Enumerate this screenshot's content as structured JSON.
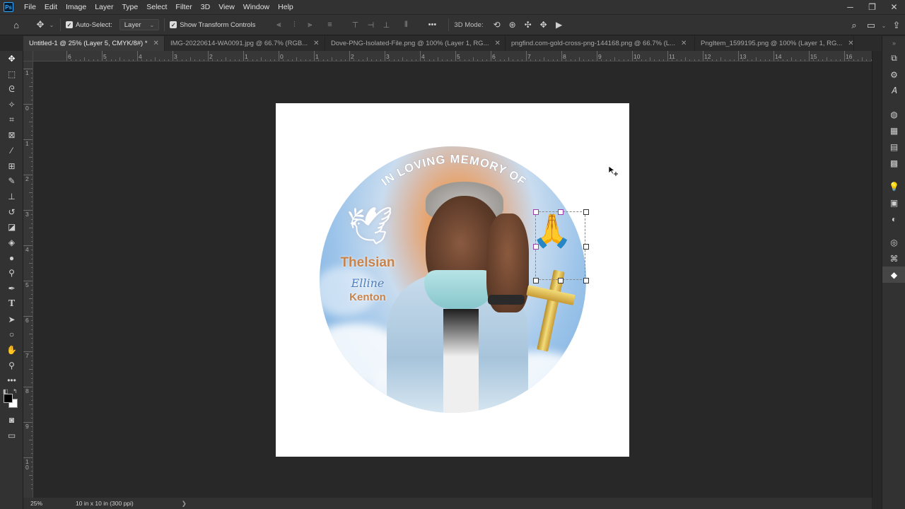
{
  "app": {
    "logo_text": "Ps",
    "menu": [
      "File",
      "Edit",
      "Image",
      "Layer",
      "Type",
      "Select",
      "Filter",
      "3D",
      "View",
      "Window",
      "Help"
    ],
    "window_controls": [
      "minimize",
      "restore",
      "close"
    ]
  },
  "options_bar": {
    "auto_select_label": "Auto-Select:",
    "auto_select_checked": true,
    "layer_select_value": "Layer",
    "show_transform_label": "Show Transform Controls",
    "show_transform_checked": true,
    "more_label": "•••",
    "mode_label": "3D Mode:"
  },
  "tabs": [
    {
      "label": "Untitled-1 @ 25% (Layer 5, CMYK/8#) *",
      "active": true
    },
    {
      "label": "IMG-20220614-WA0091.jpg @ 66.7% (RGB...",
      "active": false
    },
    {
      "label": "Dove-PNG-Isolated-File.png @ 100% (Layer 1, RG...",
      "active": false
    },
    {
      "label": "pngfind.com-gold-cross-png-144168.png @ 66.7% (L...",
      "active": false
    },
    {
      "label": "PngItem_1599195.png @ 100% (Layer 1, RG...",
      "active": false
    }
  ],
  "ruler_top_labels": [
    "6",
    "5",
    "4",
    "3",
    "2",
    "1",
    "0",
    "1",
    "2",
    "3",
    "4",
    "5",
    "6",
    "7",
    "8",
    "9",
    "10",
    "11",
    "12",
    "13",
    "14",
    "15",
    "16"
  ],
  "ruler_left_labels": [
    "1",
    "0",
    "1",
    "2",
    "3",
    "4",
    "5",
    "6",
    "7",
    "8",
    "9",
    "1\n0"
  ],
  "artwork": {
    "arc_title": "IN LOVING MEMORY OF",
    "name_first": "Thelsian",
    "name_middle": "Elline",
    "name_last": "Kenton"
  },
  "status": {
    "zoom": "25%",
    "doc_info": "10 in x 10 in (300 ppi)",
    "arrow": "❯"
  },
  "colors": {
    "foreground": "#000000",
    "background": "#ffffff",
    "accent": "#31a8ff"
  }
}
